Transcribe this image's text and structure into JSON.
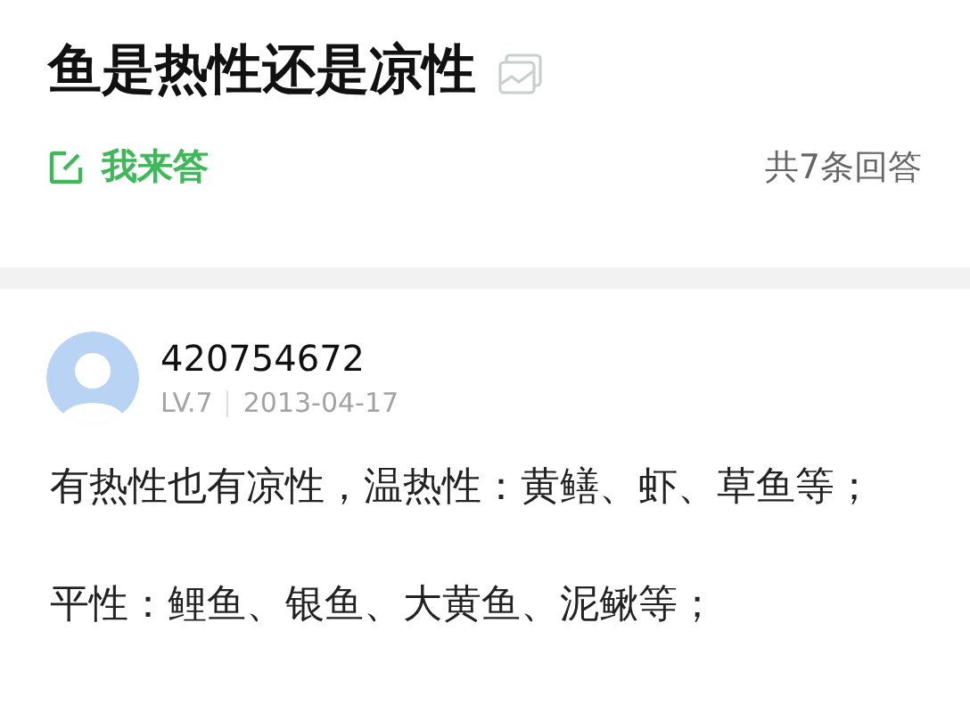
{
  "question": {
    "title": "鱼是热性还是凉性",
    "has_image": true
  },
  "actions": {
    "answer_button": "我来答",
    "answer_count": "共7条回答"
  },
  "answer": {
    "user": "420754672",
    "level": "LV.7",
    "date": "2013-04-17",
    "paragraphs": [
      "有热性也有凉性，温热性：黄鳝、虾、草鱼等；",
      "平性：鲤鱼、银鱼、大黄鱼、泥鳅等；"
    ]
  }
}
